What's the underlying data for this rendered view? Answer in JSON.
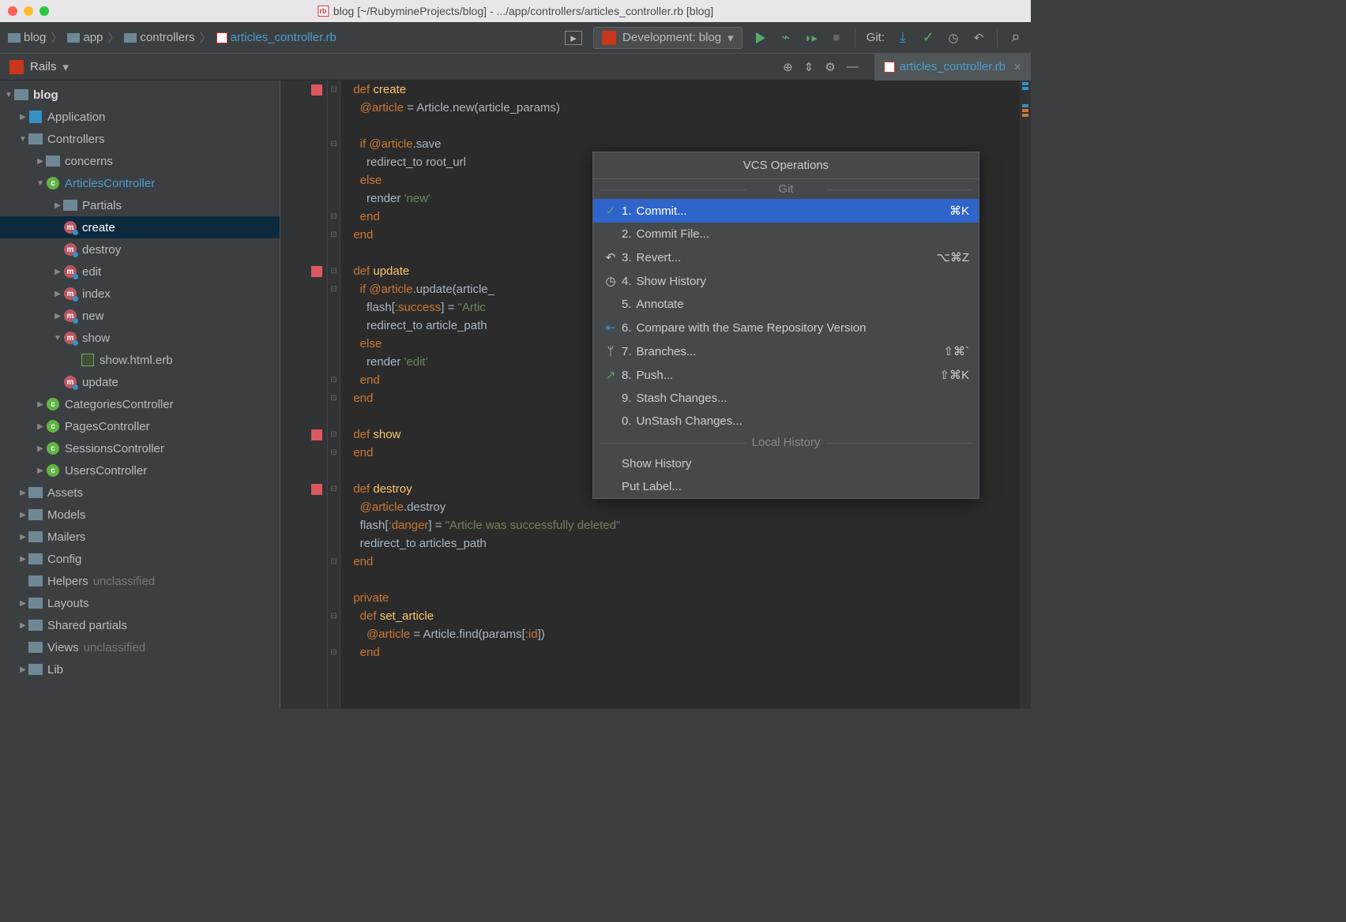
{
  "title": "blog [~/RubymineProjects/blog] - .../app/controllers/articles_controller.rb [blog]",
  "breadcrumbs": [
    "blog",
    "app",
    "controllers",
    "articles_controller.rb"
  ],
  "run_config": "Development: blog",
  "git_label": "Git:",
  "rails_label": "Rails",
  "editor_tab": "articles_controller.rb",
  "tree": {
    "root": "blog",
    "app": "Application",
    "controllers": "Controllers",
    "concerns": "concerns",
    "articles": "ArticlesController",
    "partials": "Partials",
    "create": "create",
    "destroy": "destroy",
    "edit": "edit",
    "index": "index",
    "new": "new",
    "show": "show",
    "show_erb": "show.html.erb",
    "update": "update",
    "categories": "CategoriesController",
    "pages": "PagesController",
    "sessions": "SessionsController",
    "users": "UsersController",
    "assets": "Assets",
    "models": "Models",
    "mailers": "Mailers",
    "config": "Config",
    "helpers": "Helpers",
    "helpers_u": "unclassified",
    "layouts": "Layouts",
    "shared": "Shared partials",
    "views": "Views",
    "views_u": "unclassified",
    "lib": "Lib"
  },
  "code": {
    "l1a": "def ",
    "l1b": "create",
    "l2a": "@article",
    "l2b": " = Article.",
    "l2c": "new",
    "l2d": "(article_params)",
    "l3a": "if ",
    "l3b": "@article",
    "l3c": ".save",
    "l4a": "redirect_to ",
    "l4b": "root_url",
    "l5": "else",
    "l6a": "render ",
    "l6b": "'new'",
    "l7": "end",
    "l8": "end",
    "l9a": "def ",
    "l9b": "update",
    "l10a": "if ",
    "l10b": "@article",
    "l10c": ".update(article_",
    "l11a": "flash[",
    "l11b": ":success",
    "l11c": "] = ",
    "l11d": "\"Artic",
    "l12a": "redirect_to ",
    "l12b": "article_path",
    "l13": "else",
    "l14a": "render ",
    "l14b": "'edit'",
    "l15": "end",
    "l16": "end",
    "l17a": "def ",
    "l17b": "show",
    "l18": "end",
    "l19a": "def ",
    "l19b": "destroy",
    "l20a": "@article",
    "l20b": ".destroy",
    "l21a": "flash[",
    "l21b": ":danger",
    "l21c": "] = ",
    "l21d": "\"Article was successfully deleted\"",
    "l22a": "redirect_to ",
    "l22b": "articles_path",
    "l23": "end",
    "l24": "private",
    "l25a": "def ",
    "l25b": "set_article",
    "l26a": "@article",
    "l26b": " = Article.",
    "l26c": "find",
    "l26d": "(params[",
    "l26e": ":id",
    "l26f": "])",
    "l27": "end"
  },
  "popup": {
    "title": "VCS Operations",
    "section_git": "Git",
    "section_local": "Local History",
    "items": [
      {
        "num": "1.",
        "label": "Commit...",
        "short": "⌘K",
        "icon": "✓"
      },
      {
        "num": "2.",
        "label": "Commit File...",
        "short": "",
        "icon": ""
      },
      {
        "num": "3.",
        "label": "Revert...",
        "short": "⌥⌘Z",
        "icon": "↶"
      },
      {
        "num": "4.",
        "label": "Show History",
        "short": "",
        "icon": "◷"
      },
      {
        "num": "5.",
        "label": "Annotate",
        "short": "",
        "icon": ""
      },
      {
        "num": "6.",
        "label": "Compare with the Same Repository Version",
        "short": "",
        "icon": "⇤"
      },
      {
        "num": "7.",
        "label": "Branches...",
        "short": "⇧⌘`",
        "icon": "ᛘ"
      },
      {
        "num": "8.",
        "label": "Push...",
        "short": "⇧⌘K",
        "icon": "↗"
      },
      {
        "num": "9.",
        "label": "Stash Changes...",
        "short": "",
        "icon": ""
      },
      {
        "num": "0.",
        "label": "UnStash Changes...",
        "short": "",
        "icon": ""
      }
    ],
    "local1": "Show History",
    "local2": "Put Label..."
  }
}
